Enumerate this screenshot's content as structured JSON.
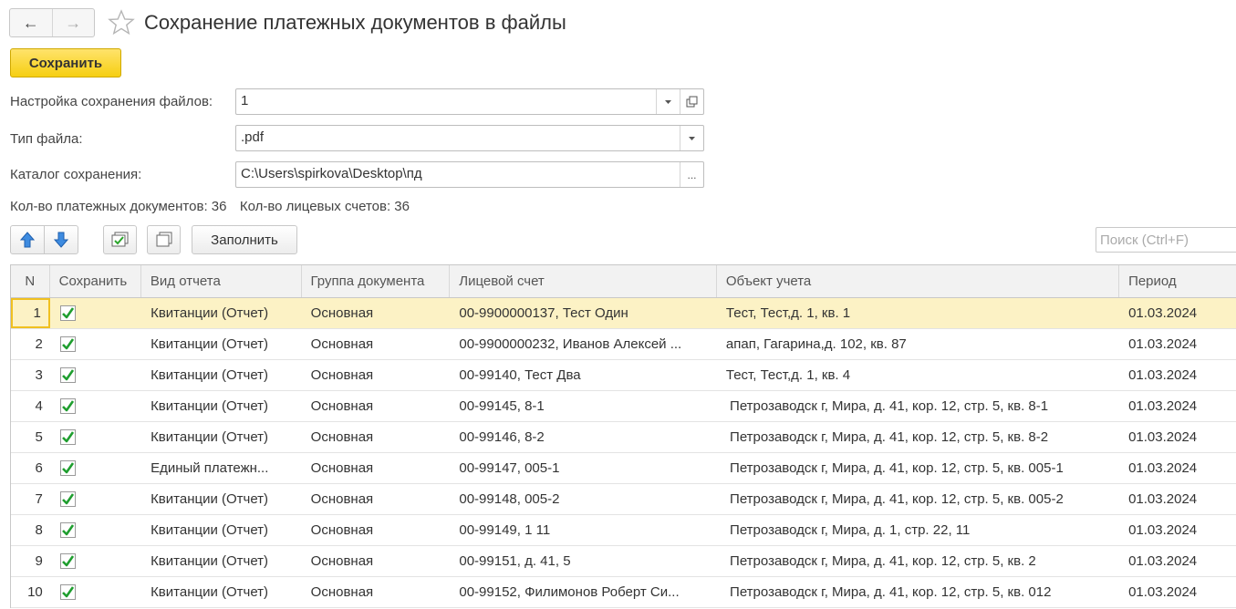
{
  "window": {
    "title": "Сохранение платежных документов в файлы",
    "back_icon": "←",
    "forward_icon": "→"
  },
  "toolbar": {
    "save_label": "Сохранить"
  },
  "form": {
    "settings_label": "Настройка сохранения файлов:",
    "settings_value": "1",
    "file_type_label": "Тип файла:",
    "file_type_value": ".pdf",
    "catalog_label": "Каталог сохранения:",
    "catalog_value": "C:\\Users\\spirkova\\Desktop\\пд",
    "browse_label": "..."
  },
  "counts": {
    "docs_label": "Кол-во платежных документов:",
    "docs_value": "36",
    "accounts_label": "Кол-во лицевых счетов:",
    "accounts_value": "36"
  },
  "list_toolbar": {
    "fill_label": "Заполнить",
    "search_placeholder": "Поиск (Ctrl+F)"
  },
  "table": {
    "columns": [
      "N",
      "Сохранить",
      "Вид отчета",
      "Группа документа",
      "Лицевой счет",
      "Объект учета",
      "Период"
    ],
    "rows": [
      {
        "n": "1",
        "checked": true,
        "vid": "Квитанции (Отчет)",
        "grp": "Основная",
        "acc": "00-9900000137, Тест Один",
        "obj": "Тест, Тест,д. 1, кв. 1",
        "per": "01.03.2024"
      },
      {
        "n": "2",
        "checked": true,
        "vid": "Квитанции (Отчет)",
        "grp": "Основная",
        "acc": "00-9900000232, Иванов Алексей ...",
        "obj": "апап, Гагарина,д. 102, кв. 87",
        "per": "01.03.2024"
      },
      {
        "n": "3",
        "checked": true,
        "vid": "Квитанции (Отчет)",
        "grp": "Основная",
        "acc": "00-99140, Тест Два",
        "obj": "Тест, Тест,д. 1, кв. 4",
        "per": "01.03.2024"
      },
      {
        "n": "4",
        "checked": true,
        "vid": "Квитанции (Отчет)",
        "grp": "Основная",
        "acc": "00-99145, 8-1",
        "obj": " Петрозаводск г, Мира, д. 41, кор. 12, стр. 5, кв. 8-1",
        "per": "01.03.2024"
      },
      {
        "n": "5",
        "checked": true,
        "vid": "Квитанции (Отчет)",
        "grp": "Основная",
        "acc": "00-99146, 8-2",
        "obj": " Петрозаводск г, Мира, д. 41, кор. 12, стр. 5, кв. 8-2",
        "per": "01.03.2024"
      },
      {
        "n": "6",
        "checked": true,
        "vid": "Единый платежн...",
        "grp": "Основная",
        "acc": "00-99147, 005-1",
        "obj": " Петрозаводск г, Мира, д. 41, кор. 12, стр. 5, кв. 005-1",
        "per": "01.03.2024"
      },
      {
        "n": "7",
        "checked": true,
        "vid": "Квитанции (Отчет)",
        "grp": "Основная",
        "acc": "00-99148, 005-2",
        "obj": " Петрозаводск г, Мира, д. 41, кор. 12, стр. 5, кв. 005-2",
        "per": "01.03.2024"
      },
      {
        "n": "8",
        "checked": true,
        "vid": "Квитанции (Отчет)",
        "grp": "Основная",
        "acc": "00-99149, 1 11",
        "obj": " Петрозаводск г, Мира, д. 1, стр. 22, 11",
        "per": "01.03.2024"
      },
      {
        "n": "9",
        "checked": true,
        "vid": "Квитанции (Отчет)",
        "grp": "Основная",
        "acc": "00-99151, д. 41, 5",
        "obj": " Петрозаводск г, Мира, д. 41, кор. 12, стр. 5, кв. 2",
        "per": "01.03.2024"
      },
      {
        "n": "10",
        "checked": true,
        "vid": "Квитанции (Отчет)",
        "grp": "Основная",
        "acc": "00-99152, Филимонов Роберт Си...",
        "obj": " Петрозаводск г, Мира, д. 41, кор. 12, стр. 5, кв. 012",
        "per": "01.03.2024"
      }
    ]
  }
}
